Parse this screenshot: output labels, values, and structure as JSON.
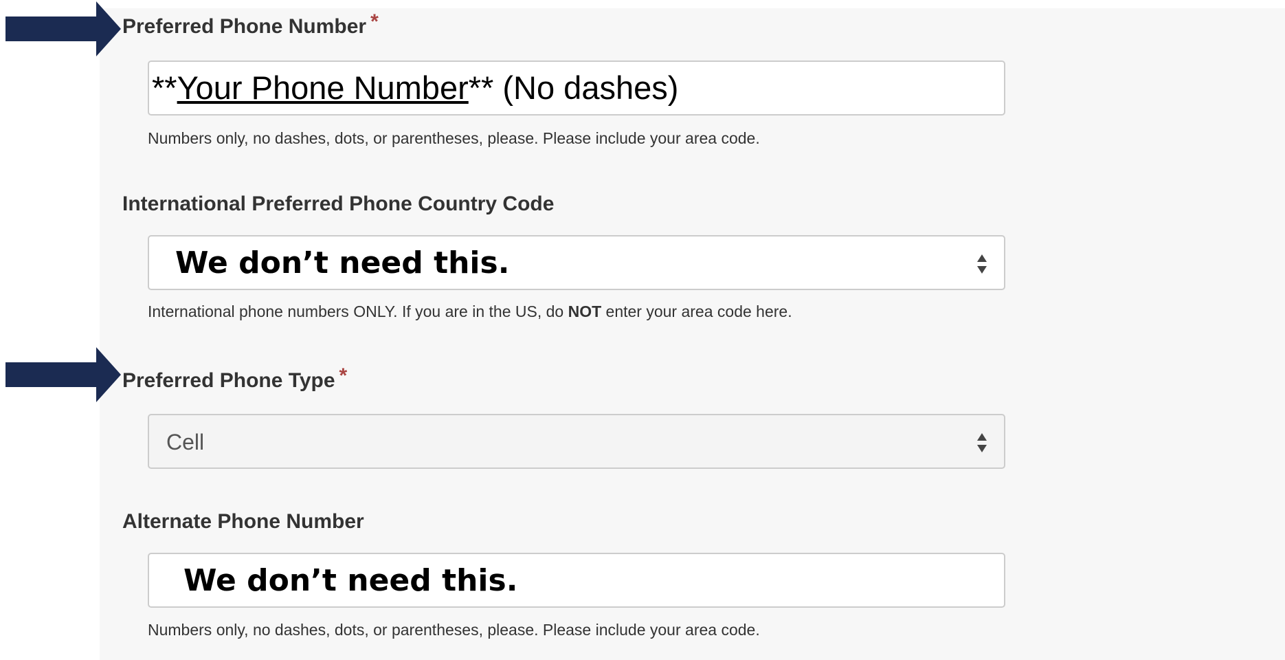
{
  "colors": {
    "arrow": "#1b2b52",
    "panel_background": "#f7f7f7",
    "required_asterisk": "#a94442",
    "label_text": "#333333",
    "field_border": "#cccccc"
  },
  "form": {
    "preferred_phone": {
      "label": "Preferred Phone Number",
      "required_marker": "*",
      "value_prefix": "**",
      "value_underlined": "Your Phone Number",
      "value_suffix": "** (No dashes)",
      "help": "Numbers only, no dashes, dots, or parentheses, please. Please include your area code."
    },
    "intl_country_code": {
      "label": "International Preferred Phone Country Code",
      "value": "We don’t need this.",
      "help_before": "International phone numbers ONLY. If you are in the US, do ",
      "help_bold": "NOT",
      "help_after": " enter your area code here."
    },
    "preferred_phone_type": {
      "label": "Preferred Phone Type",
      "required_marker": "*",
      "selected_value": "Cell"
    },
    "alternate_phone": {
      "label": "Alternate Phone Number",
      "value": "We don’t need this.",
      "help": "Numbers only, no dashes, dots, or parentheses, please. Please include your area code."
    }
  },
  "icons": {
    "arrow_1": "right-arrow-icon",
    "arrow_2": "right-arrow-icon",
    "select_caret": "sort-caret-icon"
  }
}
